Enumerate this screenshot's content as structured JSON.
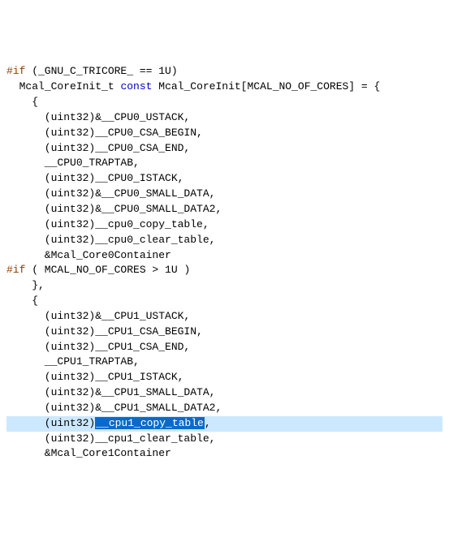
{
  "code": {
    "l1_pre": "#if",
    "l1_cond": " (_GNU_C_TRICORE_ == 1U)",
    "l2_indent": "  ",
    "l2_type": "Mcal_CoreInit_t",
    "l2_space": " ",
    "l2_const": "const",
    "l2_rest": " Mcal_CoreInit[MCAL_NO_OF_CORES] = {",
    "l3": "    {",
    "l4": "      (uint32)&__CPU0_USTACK,",
    "l5": "      (uint32)__CPU0_CSA_BEGIN,",
    "l6": "      (uint32)__CPU0_CSA_END,",
    "l7": "      __CPU0_TRAPTAB,",
    "l8": "      (uint32)__CPU0_ISTACK,",
    "l9": "      (uint32)&__CPU0_SMALL_DATA,",
    "l10": "      (uint32)&__CPU0_SMALL_DATA2,",
    "l11": "      (uint32)__cpu0_copy_table,",
    "l12": "      (uint32)__cpu0_clear_table,",
    "l13": "      &Mcal_Core0Container",
    "l14_pre": "#if",
    "l14_cond": " ( MCAL_NO_OF_CORES > 1U )",
    "l15": "    },",
    "l16": "    {",
    "l17": "      (uint32)&__CPU1_USTACK,",
    "l18": "      (uint32)__CPU1_CSA_BEGIN,",
    "l19": "      (uint32)__CPU1_CSA_END,",
    "l20": "      __CPU1_TRAPTAB,",
    "l21": "      (uint32)__CPU1_ISTACK,",
    "l22": "      (uint32)&__CPU1_SMALL_DATA,",
    "l23": "      (uint32)&__CPU1_SMALL_DATA2,",
    "l24_prefix": "      (uint32)",
    "l24_selected": "__cpu1_copy_table",
    "l24_suffix": ",",
    "l25": "      (uint32)__cpu1_clear_table,",
    "l26": "      &Mcal_Core1Container"
  }
}
